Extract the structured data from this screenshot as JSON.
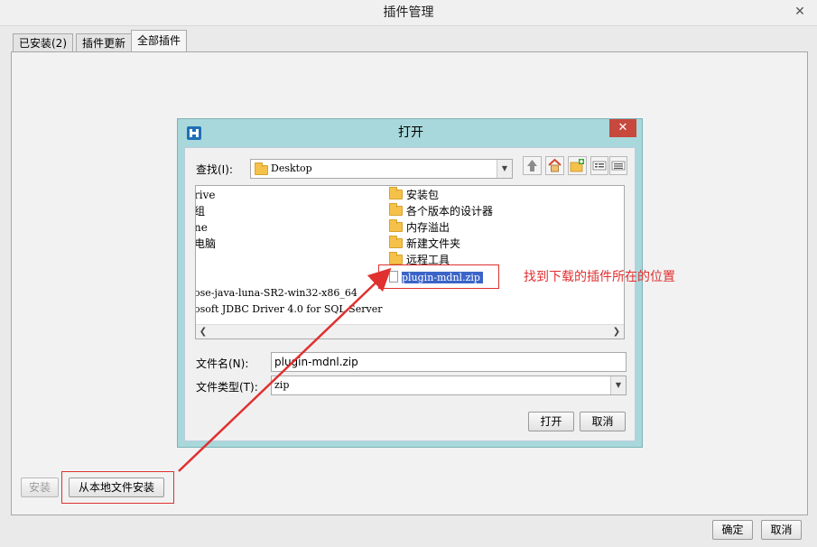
{
  "window": {
    "title": "插件管理",
    "close": "✕"
  },
  "tabs": [
    {
      "label": "已安装(2)"
    },
    {
      "label": "插件更新"
    },
    {
      "label": "全部插件"
    }
  ],
  "panel_buttons": {
    "install": "安装",
    "install_local": "从本地文件安装"
  },
  "footer_buttons": {
    "ok": "确定",
    "cancel": "取消"
  },
  "dialog": {
    "title": "打开",
    "close": "✕",
    "look_in_label": "查找(I):",
    "look_in_value": "Desktop",
    "files_left": [
      "rive",
      "组",
      "ne",
      "电脑",
      "ose-java-luna-SR2-win32-x86_64",
      "osoft JDBC Driver 4.0 for SQL Server"
    ],
    "files_right": [
      "安装包",
      "各个版本的设计器",
      "内存溢出",
      "新建文件夹",
      "远程工具",
      "plugin-mdnl.zip"
    ],
    "filename_label": "文件名(N):",
    "filename_value": "plugin-mdnl.zip",
    "filetype_label": "文件类型(T):",
    "filetype_value": "zip",
    "open_button": "打开",
    "cancel_button": "取消"
  },
  "annotation": "找到下载的插件所在的位置",
  "colors": {
    "annotation": "#e03030",
    "dialog_frame": "#a8d8db",
    "selection": "#3b64c8"
  }
}
